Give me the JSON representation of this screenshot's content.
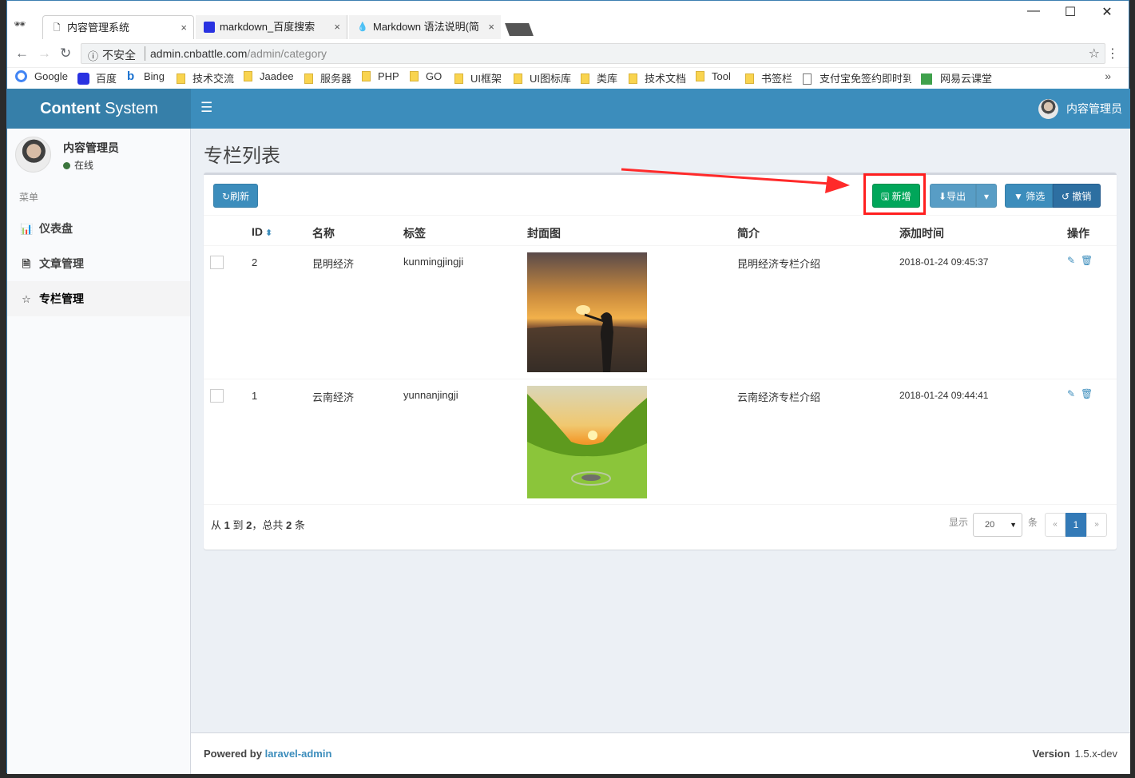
{
  "browser": {
    "tabs": [
      {
        "label": "内容管理系统"
      },
      {
        "label": "markdown_百度搜索"
      },
      {
        "label": "Markdown 语法说明(简"
      }
    ],
    "security_label": "不安全",
    "url_host": "admin.cnbattle.com",
    "url_path": "/admin/category",
    "bookmarks": [
      "Google",
      "百度",
      "Bing",
      "技术交流",
      "Jaadee",
      "服务器",
      "PHP",
      "GO",
      "UI框架",
      "UI图标库",
      "类库",
      "技术文档",
      "Tool",
      "书签栏",
      "支付宝免签约即时到帐",
      "网易云课堂"
    ],
    "bookmarks_more": "»"
  },
  "app": {
    "logo_bold": "Content",
    "logo_rest": " System",
    "header_user": "内容管理员",
    "sidebar": {
      "user_name": "内容管理员",
      "status": "在线",
      "menu_header": "菜单",
      "items": [
        {
          "label": "仪表盘",
          "icon": "bar-chart-icon"
        },
        {
          "label": "文章管理",
          "icon": "file-icon"
        },
        {
          "label": "专栏管理",
          "icon": "star-icon"
        }
      ]
    },
    "page_title": "专栏列表",
    "toolbar": {
      "refresh": "刷新",
      "new": "新增",
      "export": "导出",
      "filter": "筛选",
      "reset": "撤销"
    },
    "columns": [
      "ID",
      "名称",
      "标签",
      "封面图",
      "简介",
      "添加时间",
      "操作"
    ],
    "rows": [
      {
        "id": "2",
        "name": "昆明经济",
        "tag": "kunmingjingji",
        "intro": "昆明经济专栏介绍",
        "time": "2018-01-24 09:45:37"
      },
      {
        "id": "1",
        "name": "云南经济",
        "tag": "yunnanjingji",
        "intro": "云南经济专栏介绍",
        "time": "2018-01-24 09:44:41"
      }
    ],
    "pagination": {
      "summary_prefix": "从",
      "from": "1",
      "to_word": "到",
      "to": "2",
      "total_prefix": "，总共",
      "total": "2",
      "total_suffix": "条",
      "show_label": "显示",
      "per_page": "20",
      "unit": "条",
      "prev": "«",
      "current": "1",
      "next": "»"
    },
    "footer": {
      "powered_by": "Powered by",
      "powered_link": "laravel-admin",
      "version_label": "Version",
      "version_value": "1.5.x-dev"
    }
  },
  "colors": {
    "primary": "#3c8dbc",
    "success": "#00a65a",
    "highlight": "#ff1f1f"
  }
}
